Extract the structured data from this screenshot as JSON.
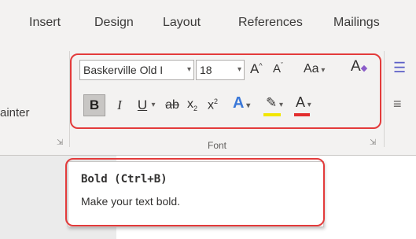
{
  "tabs": [
    "Insert",
    "Design",
    "Layout",
    "References",
    "Mailings"
  ],
  "left_group": {
    "painter_label": "ainter"
  },
  "font_group": {
    "font_name": "Baskerville Old I",
    "font_size": "18",
    "grow_font": "A",
    "shrink_font": "A",
    "change_case": "Aa",
    "clear_formatting": "A",
    "bold": "B",
    "italic": "I",
    "underline": "U",
    "strikethrough": "ab",
    "subscript": "x",
    "subscript_mark": "2",
    "superscript": "x",
    "superscript_mark": "2",
    "text_effects": "A",
    "highlight": "✎",
    "font_color": "A",
    "group_label": "Font",
    "launcher_icon": "⇲"
  },
  "tooltip": {
    "title": "Bold (Ctrl+B)",
    "description": "Make your text bold."
  },
  "colors": {
    "highlight_bar": "#f2e600",
    "font_color_bar": "#e32d2d",
    "text_effects": "#3a78d8",
    "callout_outline": "#e33b3b"
  }
}
